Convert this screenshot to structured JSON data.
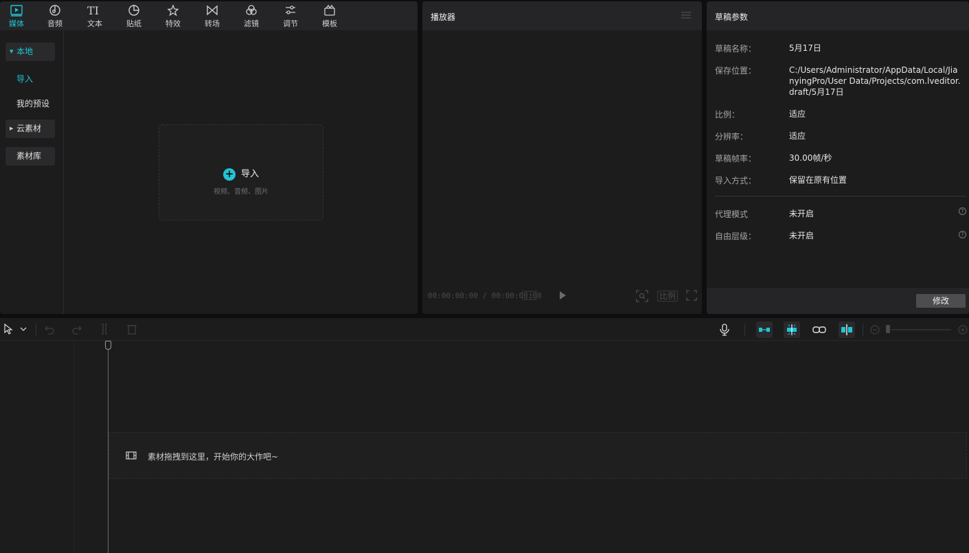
{
  "media_toolbar": {
    "tabs": [
      {
        "label": "媒体",
        "icon": "media-icon"
      },
      {
        "label": "音频",
        "icon": "audio-icon"
      },
      {
        "label": "文本",
        "icon": "text-icon"
      },
      {
        "label": "贴纸",
        "icon": "sticker-icon"
      },
      {
        "label": "特效",
        "icon": "effects-icon"
      },
      {
        "label": "转场",
        "icon": "transition-icon"
      },
      {
        "label": "滤镜",
        "icon": "filter-icon"
      },
      {
        "label": "调节",
        "icon": "adjust-icon"
      },
      {
        "label": "模板",
        "icon": "template-icon"
      }
    ]
  },
  "media_sidebar": {
    "local": "本地",
    "import": "导入",
    "my_presets": "我的预设",
    "cloud": "云素材",
    "library": "素材库"
  },
  "dropzone": {
    "title": "导入",
    "subtitle": "视频、音频、图片"
  },
  "player": {
    "title": "播放器",
    "timecode": "00:00:00:00 / 00:00:00:00",
    "ratio_label": "比例"
  },
  "draft_params": {
    "title": "草稿参数",
    "rows": [
      {
        "label": "草稿名称：",
        "value": "5月17日"
      },
      {
        "label": "保存位置：",
        "value": "C:/Users/Administrator/AppData/Local/JianyingPro/User Data/Projects/com.lveditor.draft/5月17日"
      },
      {
        "label": "比例：",
        "value": "适应"
      },
      {
        "label": "分辨率：",
        "value": "适应"
      },
      {
        "label": "草稿帧率：",
        "value": "30.00帧/秒"
      },
      {
        "label": "导入方式：",
        "value": "保留在原有位置"
      }
    ],
    "extra_rows": [
      {
        "label": "代理模式",
        "value": "未开启"
      },
      {
        "label": "自由层级：",
        "value": "未开启"
      }
    ],
    "modify_button": "修改"
  },
  "timeline": {
    "drop_hint": "素材拖拽到这里，开始你的大作吧~"
  },
  "colors": {
    "accent": "#1fc5d4",
    "panel_bg": "#1c1c1d",
    "header_bg": "#252527"
  }
}
